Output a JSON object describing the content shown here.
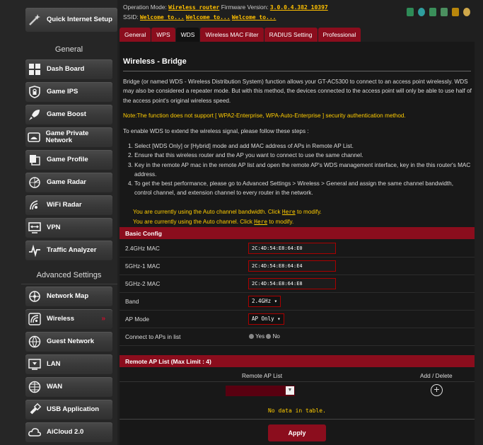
{
  "sidebar": {
    "quick_setup": "Quick Internet Setup",
    "general_header": "General",
    "advanced_header": "Advanced Settings",
    "items": [
      {
        "label": "Dash Board",
        "icon": "dashboard-icon"
      },
      {
        "label": "Game IPS",
        "icon": "lock-icon"
      },
      {
        "label": "Game Boost",
        "icon": "rocket-icon"
      },
      {
        "label": "Game Private Network",
        "icon": "game-private-network-icon"
      },
      {
        "label": "Game Profile",
        "icon": "game-profile-icon"
      },
      {
        "label": "Game Radar",
        "icon": "radar-icon"
      },
      {
        "label": "WiFi Radar",
        "icon": "wifi-radar-icon"
      },
      {
        "label": "VPN",
        "icon": "vpn-icon"
      },
      {
        "label": "Traffic Analyzer",
        "icon": "traffic-analyzer-icon"
      },
      {
        "label": "Network Map",
        "icon": "network-map-icon"
      },
      {
        "label": "Wireless",
        "icon": "wireless-icon"
      },
      {
        "label": "Guest Network",
        "icon": "guest-network-icon"
      },
      {
        "label": "LAN",
        "icon": "lan-icon"
      },
      {
        "label": "WAN",
        "icon": "globe-icon"
      },
      {
        "label": "USB Application",
        "icon": "usb-icon"
      },
      {
        "label": "AiCloud 2.0",
        "icon": "cloud-icon"
      }
    ]
  },
  "top": {
    "op_mode_label": "Operation Mode:",
    "op_mode_value": "Wireless router",
    "fw_label": "Firmware Version:",
    "fw_value": "3.0.0.4.382_10397",
    "ssid_label": "SSID:",
    "ssid_values": [
      "Welcome to...",
      "Welcome to...",
      "Welcome to..."
    ]
  },
  "tabs": [
    "General",
    "WPS",
    "WDS",
    "Wireless MAC Filter",
    "RADIUS Setting",
    "Professional"
  ],
  "page": {
    "title": "Wireless - Bridge",
    "intro": "Bridge (or named WDS - Wireless Distribution System) function allows your GT-AC5300 to connect to an access point wirelessly. WDS may also be considered a repeater mode. But with this method, the devices connected to the access point will only be able to use half of the access point's original wireless speed.",
    "note": "Note:The function does not support [ WPA2-Enterprise, WPA-Auto-Enterprise ] security authentication method.",
    "steps_intro": "To enable WDS to extend the wireless signal, please follow these steps :",
    "steps": [
      "1. Select [WDS Only] or [Hybrid] mode and add MAC address of APs in Remote AP List.",
      "2. Ensure that this wireless router and the AP you want to connect to use the same channel.",
      "3. Key in the remote AP mac in the remote AP list and open the remote AP's WDS management interface, key in the this router's MAC address.",
      "4. To get the best performance, please go to Advanced Settings > Wireless > General and assign the same channel bandwidth, control channel, and extension channel to every router in the network."
    ],
    "bw_msg_pre": "You are currently using the Auto channel bandwidth. Click ",
    "ch_msg_pre": "You are currently using the Auto channel. Click ",
    "here": "Here",
    "to_modify": " to modify."
  },
  "basic": {
    "header": "Basic Config",
    "mac24_label": "2.4GHz MAC",
    "mac24": "2C:4D:54:E8:64:E0",
    "mac5_1_label": "5GHz-1 MAC",
    "mac5_1": "2C:4D:54:E8:64:E4",
    "mac5_2_label": "5GHz-2 MAC",
    "mac5_2": "2C:4D:54:E8:64:E8",
    "band_label": "Band",
    "band_value": "2.4GHz",
    "apmode_label": "AP Mode",
    "apmode_value": "AP Only",
    "connect_label": "Connect to APs in list",
    "yes": "Yes",
    "no": "No"
  },
  "remote": {
    "header": "Remote AP List (Max Limit : 4)",
    "col_list": "Remote AP List",
    "col_action": "Add / Delete",
    "no_data": "No data in table."
  },
  "apply": "Apply",
  "colors": {
    "accent": "#8b0d1d",
    "warning": "#ffcc00"
  }
}
